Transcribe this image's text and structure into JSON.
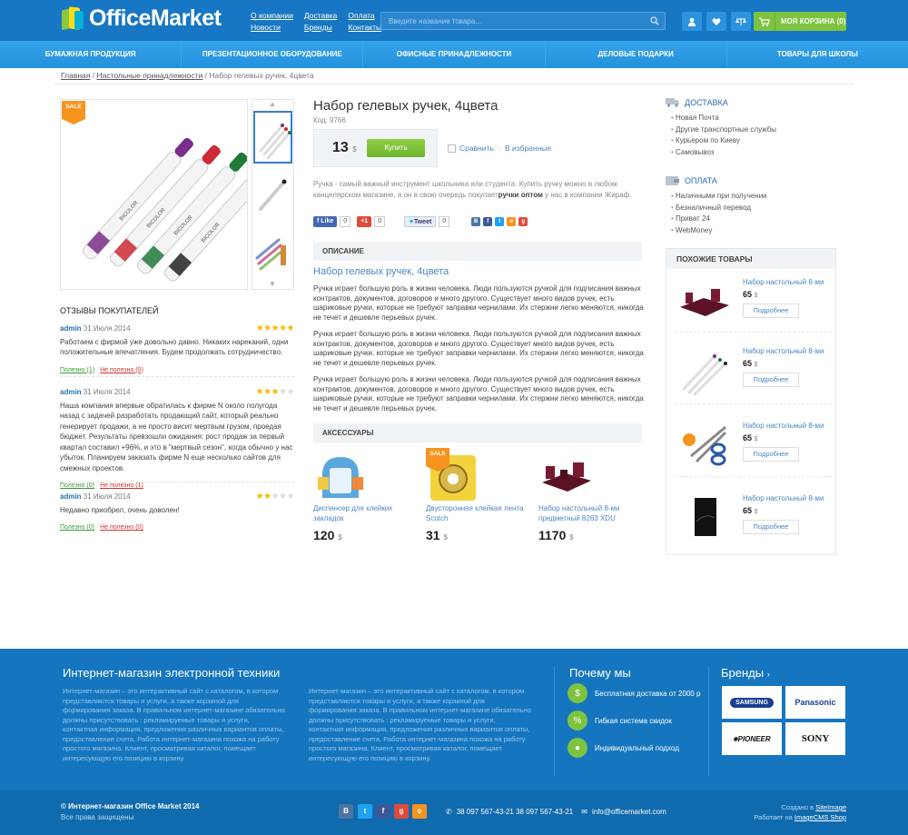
{
  "header": {
    "logo": "OfficeMarket",
    "links": [
      "О компании",
      "Доставка",
      "Оплата",
      "Новости",
      "Бренды",
      "Контакты"
    ],
    "search_placeholder": "Введите название товара...",
    "cart_label": "МОЯ КОРЗИНА (0)"
  },
  "nav": [
    "Бумажная продукция",
    "Презентационное оборудование",
    "Офисные принадлежности",
    "Деловые подарки",
    "Товары для школы"
  ],
  "breadcrumb": {
    "home": "Главная",
    "cat": "Настольные принадлежности",
    "current": "Набор гелевых ручек, 4цвета"
  },
  "product": {
    "title": "Набор гелевых ручек, 4цвета",
    "code": "Код: 9766",
    "price": "13",
    "currency": "$",
    "buy": "Купить",
    "compare": "Сравнить",
    "favorite": "В избранные",
    "sale": "SALE",
    "short": "Ручка - самый важный инструмент школьника или студента. Купить ручку можно в любом канцелярском магазине, а он в свою очередь покупает",
    "short_bold": "ручки оптом",
    "short_end": " у нас в компании Жираф.",
    "like": "Like",
    "like_count": "0",
    "gplus": "+1",
    "gplus_count": "0",
    "tweet": "Tweet",
    "tweet_count": "0"
  },
  "description": {
    "header": "ОПИСАНИЕ",
    "title": "Набор гелевых ручек, 4цвета",
    "paragraph": "Ручка играет большую роль в жизни человека. Люди пользуются ручкой для подписания важных контрактов, документов, договоров и много другого. Существует много видов ручек, есть шариковые ручки, которые не требуют заправки чернилами. Их стержни легко меняются, никогда не течет и дешевле перьевых ручек."
  },
  "accessories": {
    "header": "АКСЕССУАРЫ",
    "items": [
      {
        "name": "Диспенсер для клейких закладок",
        "price": "120"
      },
      {
        "name": "Двусторонняя клейкая лента Scotch",
        "price": "31"
      },
      {
        "name": "Набор настольный 8-ми предметный 8263 XDU",
        "price": "1170"
      }
    ]
  },
  "reviews": {
    "header": "ОТЗЫВЫ ПОКУПАТЕЛЕЙ",
    "items": [
      {
        "author": "admin",
        "date": "31 Июля 2014",
        "stars": 5,
        "text": "Работаем с фирмой уже довольно давно. Никаких нареканий, одни положительные впечатления. Будем продолжать сотрудничество.",
        "yes": "Полезно (1)",
        "no": "Не полезно (0)"
      },
      {
        "author": "admin",
        "date": "31 Июля 2014",
        "stars": 3,
        "text": "Наша компания впервые обратилась к фирме N около полугода назад с задачей разработать продающий сайт, который реально генерирует продажи, а не просто висит мертвым грузом, проедая бюджет. Результаты превзошли ожидания: рост продаж за первый квартал составил +96%, и это в \"мертвый сезон\", когда обычно у нас убыток. Планируем заказать фирме N еще несколько сайтов для смежных проектов.",
        "yes": "Полезно (0)",
        "no": "Не полезно (1)"
      },
      {
        "author": "admin",
        "date": "31 Июля 2014",
        "stars": 2,
        "text": "Недавно приобрел, очень доволен!",
        "yes": "Полезно (0)",
        "no": "Не полезно (0)"
      }
    ]
  },
  "delivery": {
    "title": "ДОСТАВКА",
    "items": [
      "Новая Почта",
      "Другие транспортные службы",
      "Курьером по Киеву",
      "Самовывоз"
    ]
  },
  "payment": {
    "title": "ОПЛАТА",
    "items": [
      "Наличными при получении",
      "Безналичный перевод",
      "Приват 24",
      "WebMoney"
    ]
  },
  "similar": {
    "header": "ПОХОЖИЕ ТОВАРЫ",
    "items": [
      {
        "name": "Набор настольный 8-ми",
        "price": "65",
        "currency": "$",
        "more": "Подробнее"
      },
      {
        "name": "Набор настольный 8-ми",
        "price": "65",
        "currency": "$",
        "more": "Подробнее"
      },
      {
        "name": "Набор настольный 8-ми",
        "price": "65",
        "currency": "$",
        "more": "Подробнее"
      },
      {
        "name": "Набор настольный 8-ми",
        "price": "65",
        "currency": "$",
        "more": "Подробнее"
      }
    ]
  },
  "footer": {
    "title": "Интернет-магазин электронной техники",
    "text": "Интернет-магазин – это интерактивный сайт с каталогом, в котором представляются товары и услуги, а также корзиной для формирования заказа. В правильном интернет-магазине обязательно должны присутствовать : рекламируемые товары и услуги, контактная информация, предложения различных вариантов оплаты, предоставление счета. Работа интернет-магазина похожа на работу простого магазина. Клиент, просматривая каталог, помещает интересующую его позицию в корзину.",
    "why_title": "Почему мы",
    "why": [
      "Бесплатная доставка от 2000 р",
      "Гибкая система  скидок",
      "Индивидуальный подход"
    ],
    "brands_title": "Бренды",
    "brands": [
      "SAMSUNG",
      "Panasonic",
      "PIONEER",
      "SONY"
    ],
    "copyright": "© Интернет-магазин Office Market 2014",
    "rights": "Все права защищены",
    "phones": "38 097 567-43-21   38 097 567-43-21",
    "email": "info@officemarket.com",
    "created": "Создано в ",
    "created_link": "SiteImage",
    "works": "Работает на ",
    "works_link": "ImageCMS Shop"
  }
}
